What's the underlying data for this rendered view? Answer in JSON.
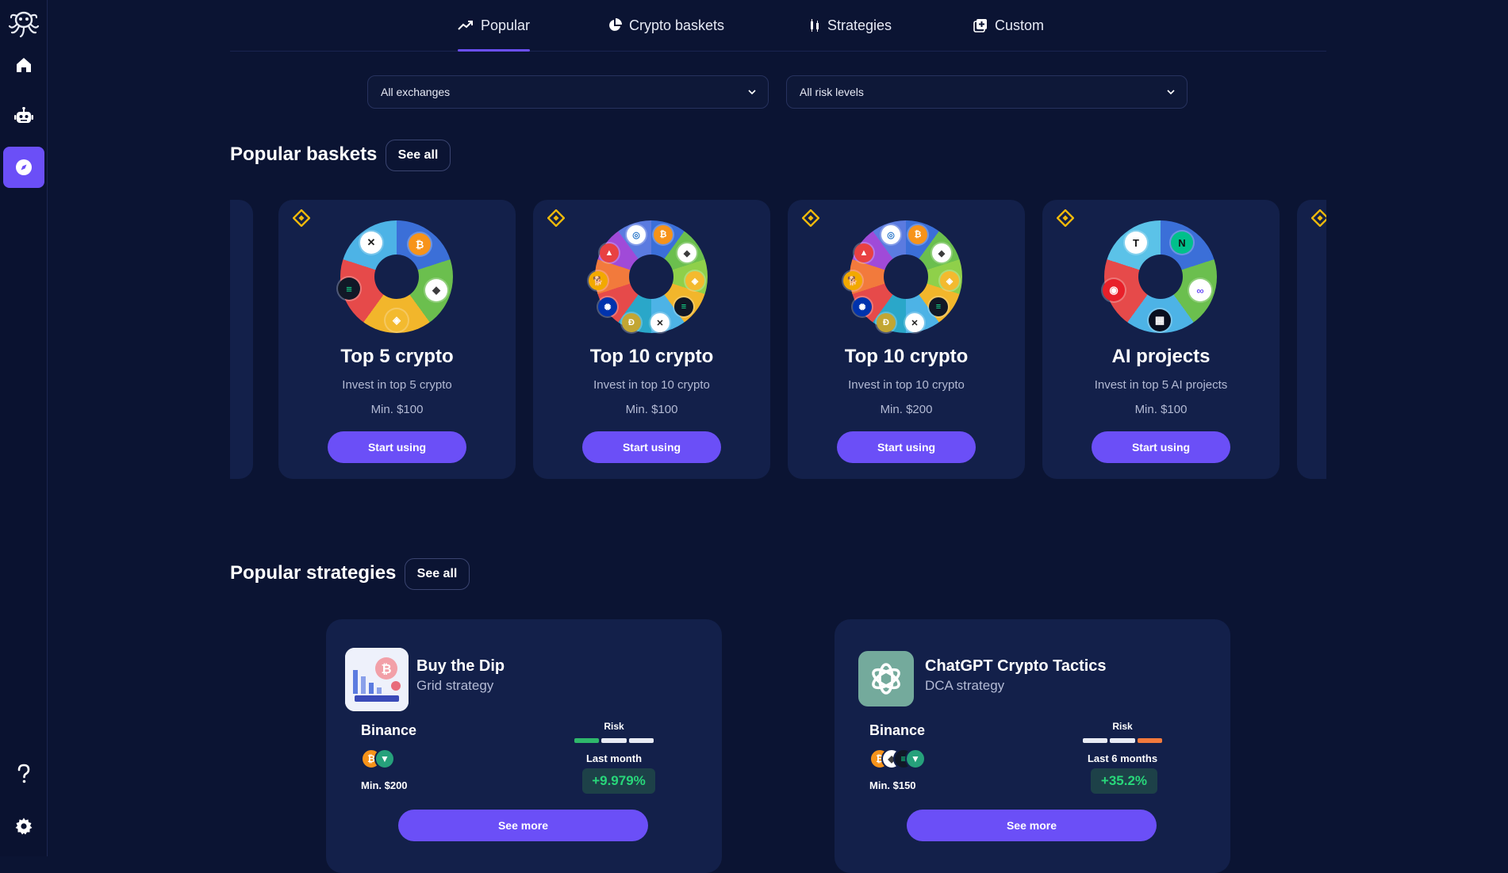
{
  "sidebar": {
    "items": [
      {
        "icon": "octopus-logo-icon"
      },
      {
        "icon": "home-icon"
      },
      {
        "icon": "robot-icon"
      },
      {
        "icon": "compass-icon",
        "active": true
      },
      {
        "icon": "question-icon"
      },
      {
        "icon": "gear-icon"
      }
    ]
  },
  "tabs": [
    {
      "label": "Popular",
      "icon": "trending-up-icon",
      "active": true
    },
    {
      "label": "Crypto baskets",
      "icon": "pie-chart-icon"
    },
    {
      "label": "Strategies",
      "icon": "candlestick-icon"
    },
    {
      "label": "Custom",
      "icon": "add-box-icon"
    }
  ],
  "filters": {
    "exchange": {
      "value": "All exchanges"
    },
    "risk": {
      "value": "All risk levels"
    }
  },
  "baskets_section": {
    "title": "Popular baskets",
    "see_all": "See all",
    "cards": [
      {
        "name": "Top 5 crypto",
        "description": "Invest in top 5 crypto",
        "min": "Min. $100",
        "button": "Start using"
      },
      {
        "name": "Top 10 crypto",
        "description": "Invest in top 10 crypto",
        "min": "Min. $100",
        "button": "Start using"
      },
      {
        "name": "Top 10 crypto",
        "description": "Invest in top 10 crypto",
        "min": "Min. $200",
        "button": "Start using"
      },
      {
        "name": "AI projects",
        "description": "Invest in top 5 AI projects",
        "min": "Min. $100",
        "button": "Start using"
      }
    ]
  },
  "strategies_section": {
    "title": "Popular strategies",
    "see_all": "See all",
    "cards": [
      {
        "name": "Buy the Dip",
        "type": "Grid strategy",
        "exchange": "Binance",
        "min": "Min. $200",
        "risk_label": "Risk",
        "period": "Last month",
        "gain": "+9.979%",
        "button": "See more",
        "risk_colors": [
          "#2fb86b",
          "#e8ebf4",
          "#e8ebf4"
        ]
      },
      {
        "name": "ChatGPT Crypto Tactics",
        "type": "DCA strategy",
        "exchange": "Binance",
        "min": "Min. $150",
        "risk_label": "Risk",
        "period": "Last 6 months",
        "gain": "+35.2%",
        "button": "See more",
        "risk_colors": [
          "#e8ebf4",
          "#e8ebf4",
          "#f27a3c"
        ]
      }
    ]
  },
  "colors": {
    "background": "#0b1433",
    "card": "#13204a",
    "accent": "#6b4ff7",
    "gain": "#28d77a"
  }
}
